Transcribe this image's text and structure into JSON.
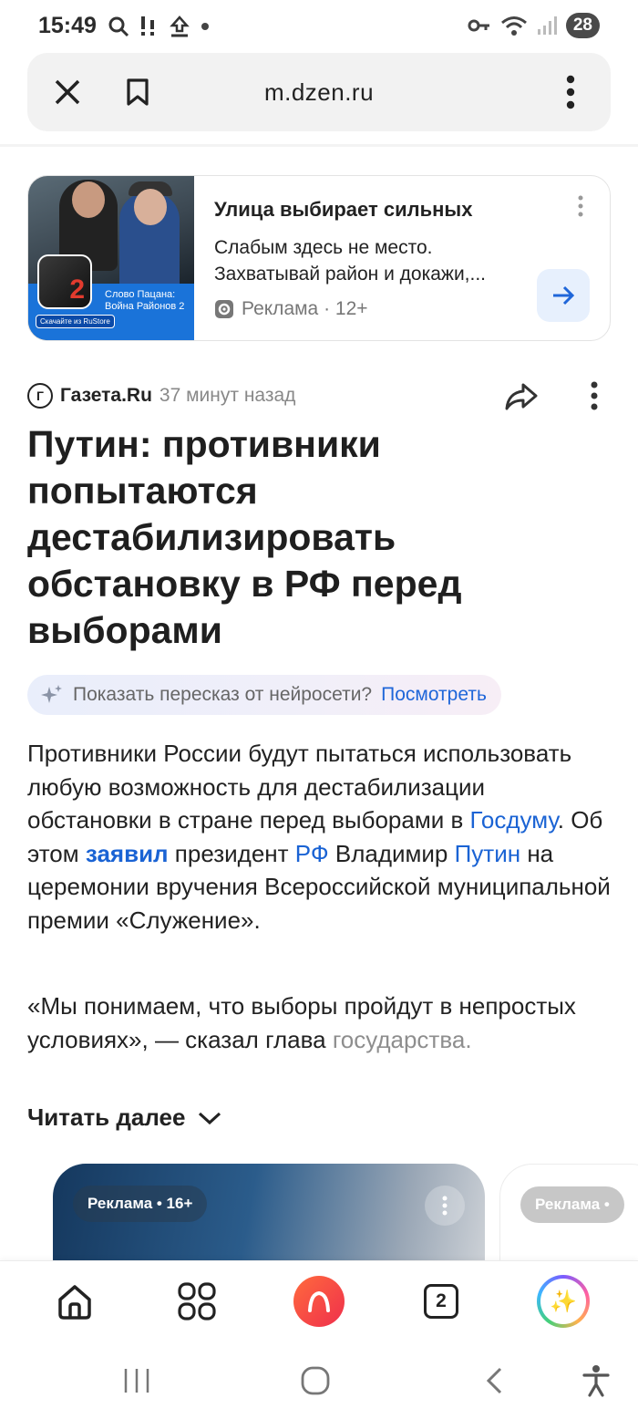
{
  "status_bar": {
    "time": "15:49",
    "battery": "28",
    "icons": [
      "search-icon",
      "alert-icon",
      "upload-icon",
      "dot-icon",
      "key-icon",
      "wifi-icon",
      "signal-icon"
    ]
  },
  "browser": {
    "url": "m.dzen.ru",
    "close_icon": "close-icon",
    "bookmark_icon": "bookmark-icon",
    "menu_icon": "kebab-menu-icon"
  },
  "ad_card": {
    "title": "Улица выбирает сильных",
    "description": "Слабым здесь не место. Захватывай район и докажи,...",
    "label": "Реклама · 12+",
    "image_caption": "Слово Пацана: Война Районов 2",
    "image_number": "2",
    "store_badge": "Скачайте из RuStore",
    "arrow_icon": "arrow-right-icon"
  },
  "article": {
    "source_logo": "Г",
    "source_name": "Газета.Ru",
    "time_ago": "37 минут назад",
    "headline": "Путин: противники попытаются дестабилизировать обстановку в РФ перед выборами",
    "ai_summary": {
      "question": "Показать пересказ от нейросети?",
      "link": "Посмотреть"
    },
    "paragraph1": {
      "p1": "Противники России будут пытаться использовать любую возможность для дестабилизации обстановки в стране перед выборами в ",
      "link1": "Госдуму",
      "p2": ". Об этом ",
      "link2": "заявил",
      "p3": " президент ",
      "link3": "РФ",
      "p4": " Владимир ",
      "link4": "Путин",
      "p5": " на церемонии вручения Всероссийской муниципальной премии «Служение»."
    },
    "paragraph2": {
      "main": "«Мы понимаем, что выборы пройдут в непростых условиях», — сказал глава ",
      "faded": "государства."
    },
    "read_more": "Читать далее"
  },
  "carousel": {
    "card1_label": "Реклама • 16+",
    "card2_label": "Реклама •"
  },
  "bottom_nav": {
    "tabs_count": "2",
    "items": [
      "home-icon",
      "apps-grid-icon",
      "alice-icon",
      "tabs-icon",
      "ai-assistant-icon"
    ],
    "ai_glyph": "✨"
  },
  "system_nav": {
    "items": [
      "recents-icon",
      "home-circle-icon",
      "back-icon",
      "accessibility-icon"
    ]
  },
  "colors": {
    "link": "#1a63d4",
    "accent_blue": "#1f66d9",
    "alice_orange": "#ff6a3d",
    "ad_blue": "#1a73d9"
  }
}
